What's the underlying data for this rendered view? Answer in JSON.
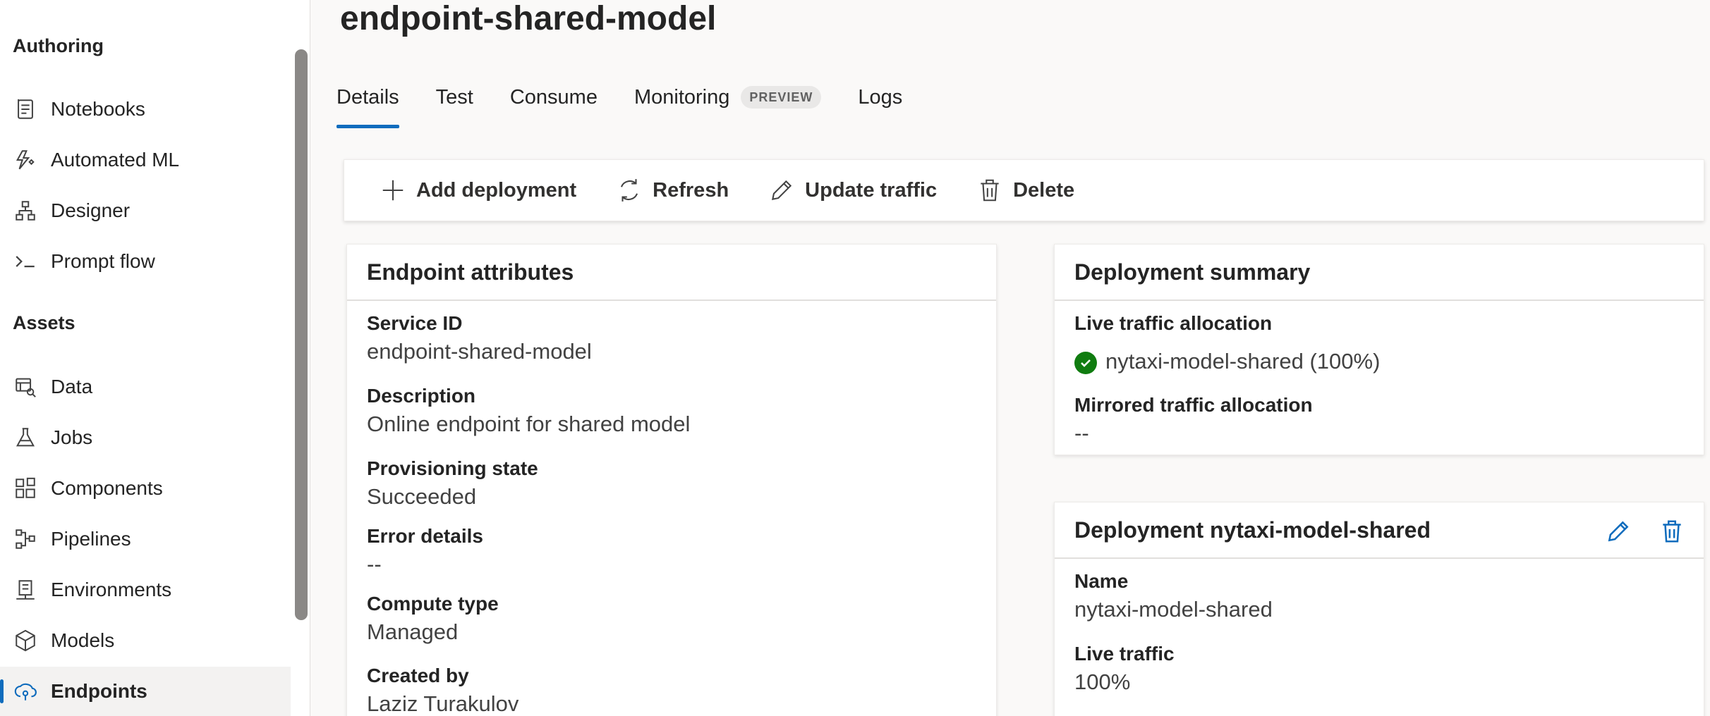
{
  "sidebar": {
    "authoring_title": "Authoring",
    "assets_title": "Assets",
    "authoring_items": [
      {
        "label": "Notebooks",
        "icon": "notebook-icon"
      },
      {
        "label": "Automated ML",
        "icon": "automated-ml-icon"
      },
      {
        "label": "Designer",
        "icon": "designer-icon"
      },
      {
        "label": "Prompt flow",
        "icon": "prompt-flow-icon"
      }
    ],
    "asset_items": [
      {
        "label": "Data",
        "icon": "data-icon"
      },
      {
        "label": "Jobs",
        "icon": "jobs-icon"
      },
      {
        "label": "Components",
        "icon": "components-icon"
      },
      {
        "label": "Pipelines",
        "icon": "pipelines-icon"
      },
      {
        "label": "Environments",
        "icon": "environments-icon"
      },
      {
        "label": "Models",
        "icon": "models-icon"
      },
      {
        "label": "Endpoints",
        "icon": "endpoints-icon",
        "active": true
      }
    ]
  },
  "page": {
    "title": "endpoint-shared-model"
  },
  "tabs": [
    {
      "label": "Details",
      "active": true
    },
    {
      "label": "Test"
    },
    {
      "label": "Consume"
    },
    {
      "label": "Monitoring",
      "badge": "PREVIEW"
    },
    {
      "label": "Logs"
    }
  ],
  "toolbar": {
    "add_deployment": "Add deployment",
    "refresh": "Refresh",
    "update_traffic": "Update traffic",
    "delete": "Delete"
  },
  "endpoint_attributes": {
    "title": "Endpoint attributes",
    "fields": [
      {
        "label": "Service ID",
        "value": "endpoint-shared-model"
      },
      {
        "label": "Description",
        "value": "Online endpoint for shared model"
      },
      {
        "label": "Provisioning state",
        "value": "Succeeded"
      },
      {
        "label": "Error details",
        "value": "--"
      },
      {
        "label": "Compute type",
        "value": "Managed"
      },
      {
        "label": "Created by",
        "value": "Laziz Turakulov"
      }
    ]
  },
  "deployment_summary": {
    "title": "Deployment summary",
    "live_label": "Live traffic allocation",
    "live_value": "nytaxi-model-shared (100%)",
    "mirrored_label": "Mirrored traffic allocation",
    "mirrored_value": "--"
  },
  "deployment": {
    "title": "Deployment nytaxi-model-shared",
    "name_label": "Name",
    "name_value": "nytaxi-model-shared",
    "traffic_label": "Live traffic",
    "traffic_value": "100%"
  },
  "colors": {
    "accent": "#0f6cbd",
    "success": "#107c10"
  }
}
